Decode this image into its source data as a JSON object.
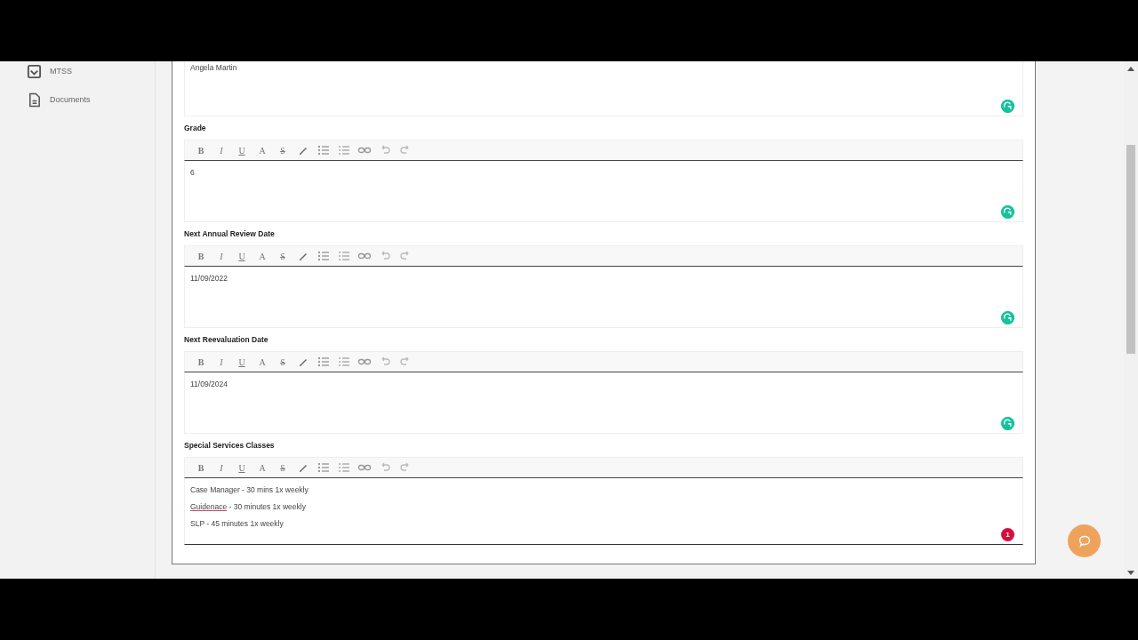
{
  "sidebar": {
    "items": [
      {
        "label": "MTSS"
      },
      {
        "label": "Documents"
      }
    ]
  },
  "form": {
    "fields": [
      {
        "lines": [
          [
            {
              "text": "Angela Martin",
              "misspelled": false
            }
          ]
        ],
        "checker": {
          "kind": "ok"
        }
      },
      {
        "label": "Grade",
        "toolbar": [
          "B",
          "I",
          "U",
          "A",
          "S"
        ],
        "lines": [
          [
            {
              "text": "6",
              "misspelled": false
            }
          ]
        ],
        "checker": {
          "kind": "ok"
        }
      },
      {
        "label": "Next Annual Review Date",
        "toolbar": [
          "B",
          "I",
          "U",
          "A",
          "S"
        ],
        "lines": [
          [
            {
              "text": "11/09/2022",
              "misspelled": false
            }
          ]
        ],
        "checker": {
          "kind": "ok"
        }
      },
      {
        "label": "Next Reevaluation Date",
        "toolbar": [
          "B",
          "I",
          "U",
          "A",
          "S"
        ],
        "lines": [
          [
            {
              "text": "11/09/2024",
              "misspelled": false
            }
          ]
        ],
        "checker": {
          "kind": "ok"
        }
      },
      {
        "label": "Special Services Classes",
        "toolbar": [
          "B",
          "I",
          "U",
          "A",
          "S"
        ],
        "lines": [
          [
            {
              "text": "Case Manager - 30 mins 1x weekly",
              "misspelled": false
            }
          ],
          [
            {
              "text": "Guidenace",
              "misspelled": true
            },
            {
              "text": " - 30 minutes 1x weekly",
              "misspelled": false
            }
          ],
          [
            {
              "text": "SLP - 45 minutes 1x weekly",
              "misspelled": false
            }
          ]
        ],
        "checker": {
          "kind": "issues",
          "count": "1"
        }
      }
    ]
  }
}
